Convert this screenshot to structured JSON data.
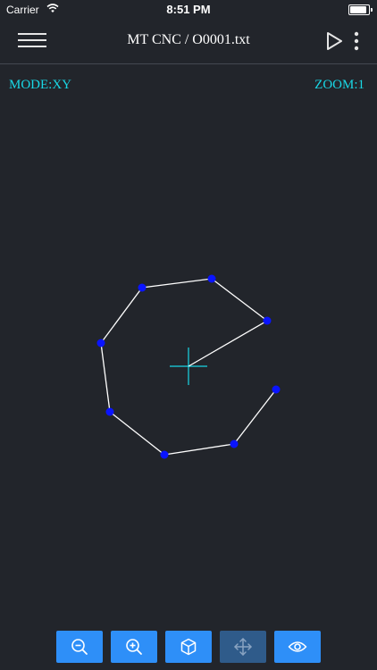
{
  "status_bar": {
    "carrier": "Carrier",
    "time": "8:51 PM",
    "battery_level": 1.0
  },
  "header": {
    "title": "MT CNC / O0001.txt",
    "icons": [
      "hamburger-menu-icon",
      "play-icon",
      "more-vertical-icon"
    ]
  },
  "viewport": {
    "mode": "MODE:XY",
    "zoom": "ZOOM:1",
    "path_color": "#ffffff",
    "point_color": "#0a14ff",
    "crosshair_color": "#19d8e6"
  },
  "toolbar": {
    "buttons": [
      {
        "icon": "zoom-out-icon",
        "enabled": true
      },
      {
        "icon": "zoom-in-icon",
        "enabled": true
      },
      {
        "icon": "cube-3d-icon",
        "enabled": true
      },
      {
        "icon": "move-arrows-icon",
        "enabled": false
      },
      {
        "icon": "eye-icon",
        "enabled": true
      }
    ],
    "accent": "#2e8ff8"
  }
}
